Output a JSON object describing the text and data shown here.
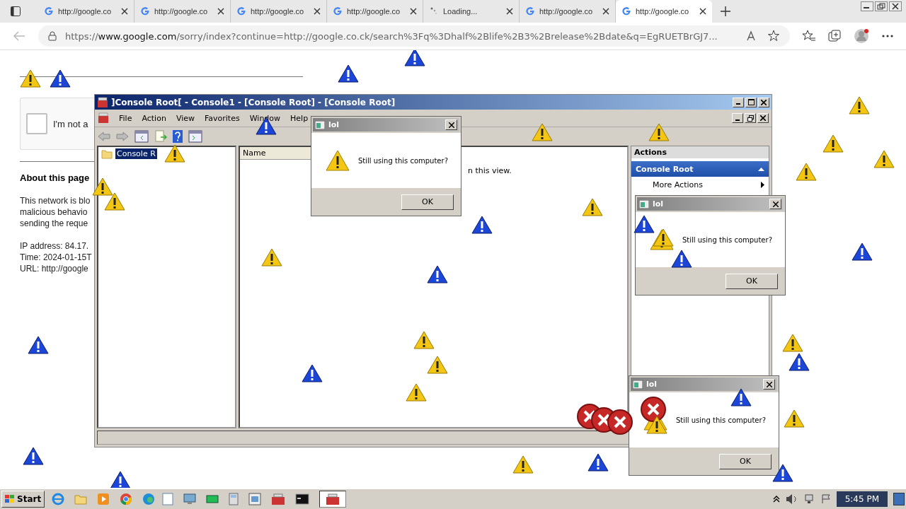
{
  "browser": {
    "tabs": [
      {
        "title": "http://google.co",
        "kind": "page",
        "selected": false
      },
      {
        "title": "http://google.co",
        "kind": "page",
        "selected": false
      },
      {
        "title": "http://google.co",
        "kind": "page",
        "selected": false
      },
      {
        "title": "http://google.co",
        "kind": "page",
        "selected": false
      },
      {
        "title": "Loading...",
        "kind": "loading",
        "selected": false
      },
      {
        "title": "http://google.co",
        "kind": "page",
        "selected": false
      },
      {
        "title": "http://google.co",
        "kind": "page",
        "selected": true
      }
    ],
    "url_host": "https://www.google.com",
    "url_rest": "/sorry/index?continue=http://google.co.ck/search%3Fq%3Dhalf%2Blife%2B3%2Brelease%2Bdate&q=EgRUETBrGJ7..."
  },
  "page": {
    "captcha": {
      "label": "I'm not a",
      "checked": false
    },
    "heading": "About this page",
    "lines": [
      "This network is blo",
      "malicious behavio",
      "sending the reque"
    ],
    "details": [
      "IP address: 84.17.",
      "Time: 2024-01-15T",
      "URL: http://google"
    ]
  },
  "console": {
    "title": "]Console Root[ - Console1 - [Console Root] - [Console Root]",
    "menu": [
      "File",
      "Action",
      "View",
      "Favorites",
      "Window",
      "Help"
    ],
    "tree_item": {
      "label": "Console R",
      "selected": true
    },
    "column": "Name",
    "empty_text": "n this view.",
    "actions": {
      "title": "Actions",
      "section": "Console Root",
      "item": "More Actions"
    }
  },
  "dialogs": [
    {
      "title": "lol",
      "message": "Still using this computer?",
      "button": "OK"
    },
    {
      "title": "lol",
      "message": "Still using this computer?",
      "button": "OK"
    },
    {
      "title": "lol",
      "message": "Still using this computer?",
      "button": "OK"
    }
  ],
  "taskbar": {
    "start": "Start",
    "time": "5:45 PM"
  }
}
